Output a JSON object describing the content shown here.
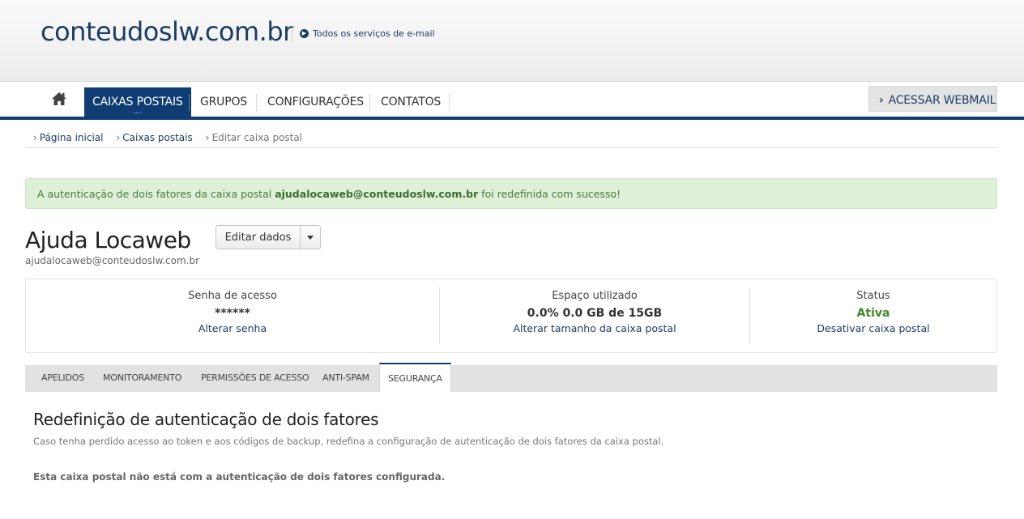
{
  "header": {
    "domain": "conteudoslw.com.br",
    "all_services": "Todos os serviços de e-mail"
  },
  "nav": {
    "home_icon": "home-icon",
    "items": [
      "CAIXAS POSTAIS",
      "GRUPOS",
      "CONFIGURAÇÕES",
      "CONTATOS"
    ],
    "active": "CAIXAS POSTAIS",
    "webmail": "ACESSAR WEBMAIL",
    "accent_color": "#0f3d73"
  },
  "breadcrumb": [
    "Página inicial",
    "Caixas postais",
    "Editar caixa postal"
  ],
  "alert": {
    "prefix": "A autenticação de dois fatores da caixa postal ",
    "email": "ajudalocaweb@conteudoslw.com.br",
    "suffix": " foi redefinida com sucesso!"
  },
  "mailbox": {
    "name": "Ajuda Locaweb",
    "email": "ajudalocaweb@conteudoslw.com.br",
    "edit_button": "Editar dados"
  },
  "stats": {
    "password": {
      "label": "Senha de acesso",
      "value": "******",
      "action": "Alterar senha"
    },
    "space": {
      "label": "Espaço utilizado",
      "value": "0.0% 0.0 GB de 15GB",
      "action": "Alterar tamanho da caixa postal"
    },
    "status": {
      "label": "Status",
      "value": "Ativa",
      "action": "Desativar caixa postal"
    }
  },
  "tabs": [
    "APELIDOS",
    "MONITORAMENTO",
    "PERMISSÕES DE ACESSO",
    "ANTI-SPAM",
    "SEGURANÇA"
  ],
  "active_tab": "SEGURANÇA",
  "section": {
    "title": "Redefinição de autenticação de dois fatores",
    "description": "Caso tenha perdido acesso ao token e aos códigos de backup, redefina a configuração de autenticação de dois fatores da caixa postal.",
    "note": "Esta caixa postal não está com a autenticação de dois fatores configurada."
  }
}
